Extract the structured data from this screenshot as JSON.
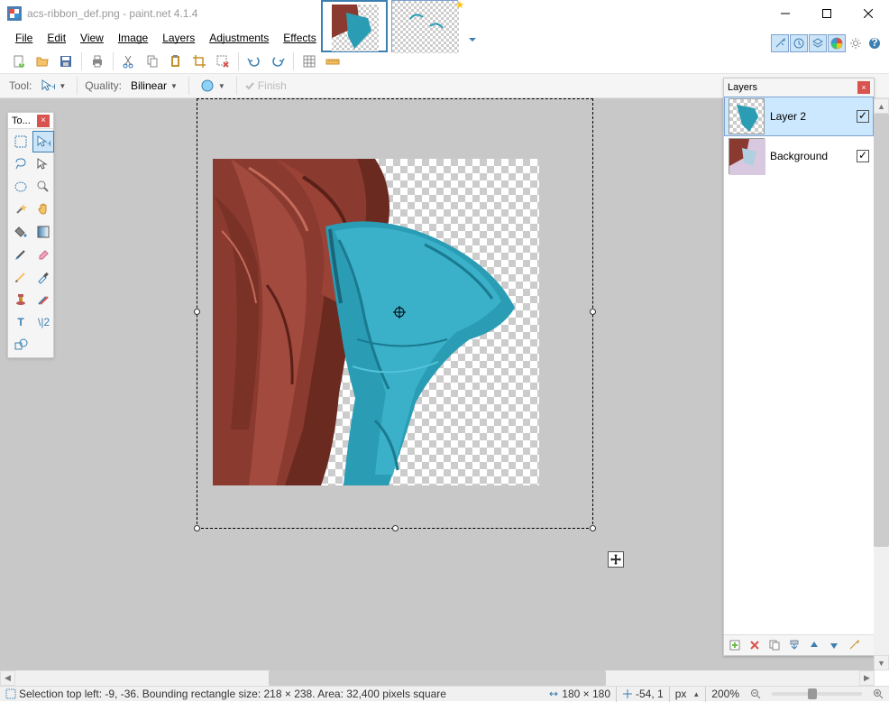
{
  "title": "acs-ribbon_def.png - paint.net 4.1.4",
  "menu": {
    "file": "File",
    "edit": "Edit",
    "view": "View",
    "image": "Image",
    "layers": "Layers",
    "adjustments": "Adjustments",
    "effects": "Effects"
  },
  "ctx": {
    "tool_label": "Tool:",
    "quality_label": "Quality:",
    "quality_value": "Bilinear",
    "finish": "Finish"
  },
  "toolbox": {
    "title": "To..."
  },
  "layers": {
    "title": "Layers",
    "items": [
      {
        "name": "Layer 2",
        "visible": true
      },
      {
        "name": "Background",
        "visible": true
      }
    ]
  },
  "status": {
    "selection": "Selection top left: -9, -36. Bounding rectangle size: 218 × 238. Area: 32,400 pixels square",
    "canvas_size": "180 × 180",
    "cursor": "-54, 1",
    "unit": "px",
    "zoom": "200%"
  }
}
